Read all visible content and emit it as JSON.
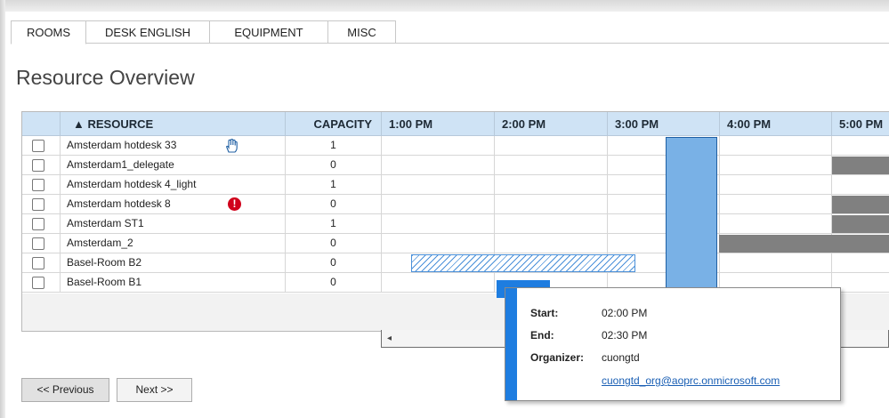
{
  "tabs": [
    {
      "label": "ROOMS",
      "active": true
    },
    {
      "label": "DESK ENGLISH",
      "active": false
    },
    {
      "label": "EQUIPMENT",
      "active": false
    },
    {
      "label": "MISC",
      "active": false
    }
  ],
  "page_title": "Resource Overview",
  "grid": {
    "columns": {
      "resource": "▲ RESOURCE",
      "capacity": "CAPACITY",
      "times": [
        "1:00 PM",
        "2:00 PM",
        "3:00 PM",
        "4:00 PM",
        "5:00 PM"
      ]
    },
    "rows": [
      {
        "name": "Amsterdam hotdesk 33",
        "capacity": "1",
        "icon": "hand-icon"
      },
      {
        "name": "Amsterdam1_delegate",
        "capacity": "0"
      },
      {
        "name": "Amsterdam hotdesk 4_light",
        "capacity": "1"
      },
      {
        "name": "Amsterdam hotdesk 8",
        "capacity": "0",
        "icon": "warning-icon",
        "icon_glyph": "!"
      },
      {
        "name": "Amsterdam ST1",
        "capacity": "1"
      },
      {
        "name": "Amsterdam_2",
        "capacity": "0"
      },
      {
        "name": "Basel-Room B2",
        "capacity": "0"
      },
      {
        "name": "Basel-Room B1",
        "capacity": "0"
      }
    ],
    "colors": {
      "header": "#cfe3f5",
      "booked": "#808080",
      "selection": "#79b1e6",
      "appointment": "#1e7de0"
    }
  },
  "scroll": {
    "left_arrow": "◂"
  },
  "popup": {
    "start_label": "Start:",
    "start_value": "02:00 PM",
    "end_label": "End:",
    "end_value": "02:30 PM",
    "organizer_label": "Organizer:",
    "organizer_value": "cuongtd",
    "organizer_email": "cuongtd_org@aoprc.onmicrosoft.com"
  },
  "buttons": {
    "previous": "<< Previous",
    "next": "Next >>"
  }
}
